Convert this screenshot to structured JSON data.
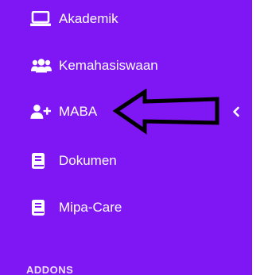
{
  "sidebar": {
    "background": "#7e17f3",
    "items": [
      {
        "label": "Akademik",
        "icon": "laptop-icon"
      },
      {
        "label": "Kemahasiswaan",
        "icon": "users-icon"
      },
      {
        "label": "MABA",
        "icon": "user-plus-icon",
        "submenu_indicator": "chevron-left-icon"
      },
      {
        "label": "Dokumen",
        "icon": "book-icon"
      },
      {
        "label": "Mipa-Care",
        "icon": "book-icon"
      }
    ],
    "section_heading": "ADDONS"
  },
  "annotation": {
    "icon": "arrow-left-outline-icon"
  }
}
